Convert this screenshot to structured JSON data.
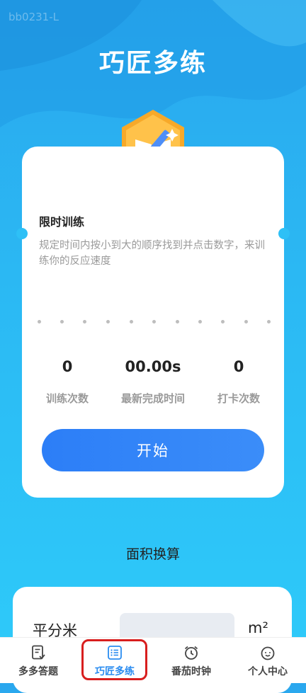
{
  "watermark": "bb0231-L",
  "app_title": "巧匠多练",
  "training_card": {
    "title": "限时训练",
    "description": "规定时间内按小到大的顺序找到并点击数字，来训练你的反应速度",
    "stats": [
      {
        "value": "0",
        "label": "训练次数"
      },
      {
        "value": "00.00s",
        "label": "最新完成时间"
      },
      {
        "value": "0",
        "label": "打卡次数"
      }
    ],
    "start_label": "开始"
  },
  "area_section": {
    "title": "面积换算",
    "unit_label": "平分米",
    "unit_input_value": "",
    "unit_symbol": "m²"
  },
  "tabbar": {
    "items": [
      {
        "label": "多多答题",
        "icon": "quiz-icon"
      },
      {
        "label": "巧匠多练",
        "icon": "list-icon"
      },
      {
        "label": "番茄时钟",
        "icon": "alarm-clock-icon"
      },
      {
        "label": "个人中心",
        "icon": "smiley-face-icon"
      }
    ],
    "active_index": 1
  },
  "colors": {
    "accent": "#2c7ef7",
    "highlight": "#d81e1e",
    "background": "#2bb8f3"
  }
}
